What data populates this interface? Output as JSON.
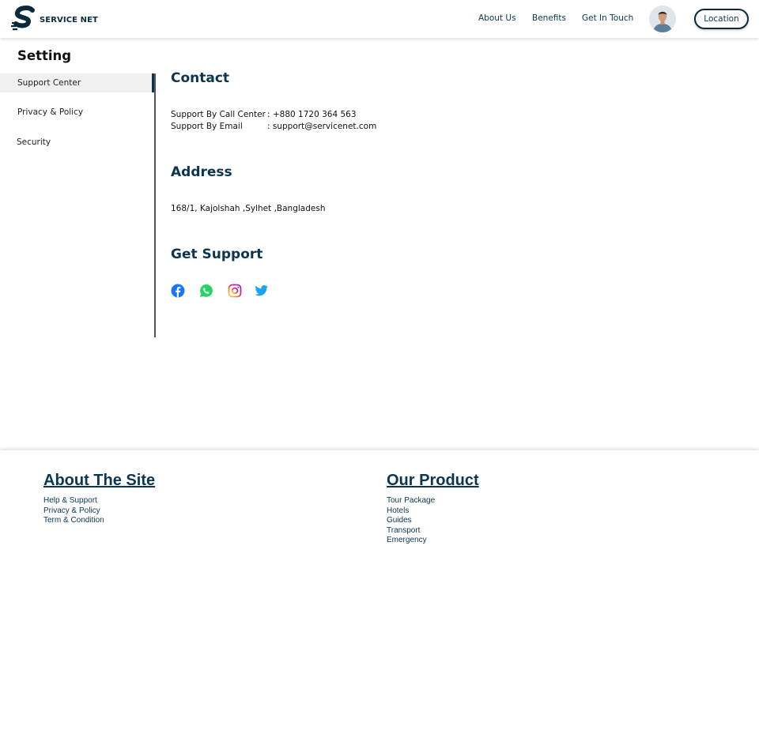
{
  "header": {
    "brand": "SERVICE NET",
    "nav": [
      "About Us",
      "Benefits",
      "Get In Touch"
    ],
    "location_button": "Location",
    "icons": {
      "logo": "service-net-logo",
      "avatar": "user-avatar"
    }
  },
  "sidebar": {
    "title": "Setting",
    "items": [
      {
        "label": "Support Center",
        "active": true
      },
      {
        "label": "Privacy & Policy",
        "active": false
      },
      {
        "label": "Security",
        "active": false
      }
    ]
  },
  "contact": {
    "heading": "Contact",
    "call_label": "Support By Call Center",
    "call_value": ": +880 1720 364 563",
    "email_label": "Support By Email",
    "email_value": ": support@servicenet.com"
  },
  "address": {
    "heading": "Address",
    "text": "168/1, Kajolshah ,Sylhet ,Bangladesh"
  },
  "support": {
    "heading": "Get Support",
    "social": [
      {
        "icon": "facebook-icon",
        "color": "#1877f2"
      },
      {
        "icon": "whatsapp-icon",
        "color": "#25d366"
      },
      {
        "icon": "instagram-icon",
        "color": "#e4405f"
      },
      {
        "icon": "twitter-icon",
        "color": "#1da1f2"
      }
    ]
  },
  "footer": {
    "about": {
      "heading": "About The Site",
      "links": [
        "Help & Support",
        "Privacy & Policy",
        "Term & Condition"
      ]
    },
    "product": {
      "heading": "Our Product",
      "links": [
        "Tour Package",
        "Hotels",
        "Guides",
        "Transport",
        "Emergency"
      ]
    }
  },
  "colors": {
    "primary": "#0b3550",
    "dark": "#0b2a3c"
  }
}
